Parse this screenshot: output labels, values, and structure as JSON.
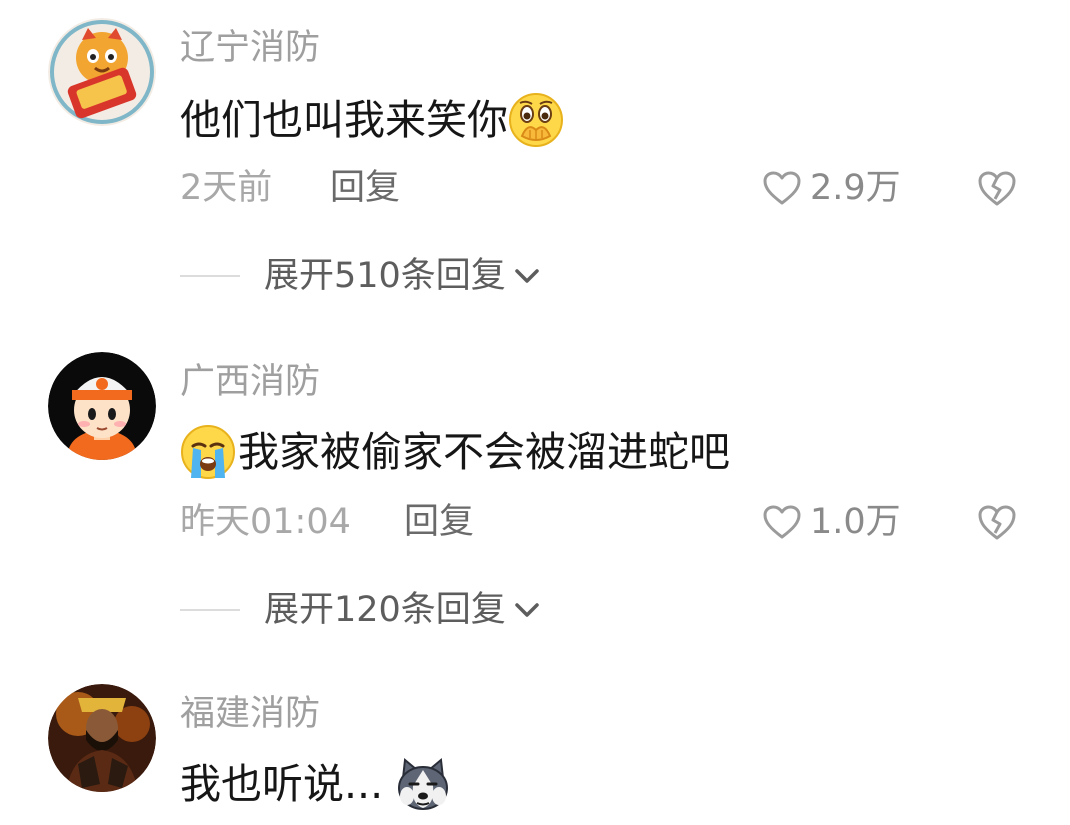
{
  "comments": [
    {
      "username": "辽宁消防",
      "avatar_icon": "tiger-mascot-avatar",
      "text": "他们也叫我来笑你",
      "emoji": "hand-over-mouth-emoji",
      "time": "2天前",
      "reply_label": "回复",
      "likes": "2.9万",
      "expand_label": "展开510条回复"
    },
    {
      "username": "广西消防",
      "avatar_icon": "firefighter-cartoon-avatar",
      "emoji": "crying-face-emoji",
      "text": "我家被偷家不会被溜进蛇吧",
      "time": "昨天01:04",
      "reply_label": "回复",
      "likes": "1.0万",
      "expand_label": "展开120条回复"
    },
    {
      "username": "福建消防",
      "avatar_icon": "opera-character-avatar",
      "text": "我也听说...",
      "emoji": "husky-dog-emoji"
    }
  ],
  "colors": {
    "username": "#9f9f9f",
    "text": "#161616",
    "meta": "#a8a8a8",
    "reply": "#6a6a6a",
    "like": "#8a8a8a",
    "expand": "#5d5d5d"
  }
}
